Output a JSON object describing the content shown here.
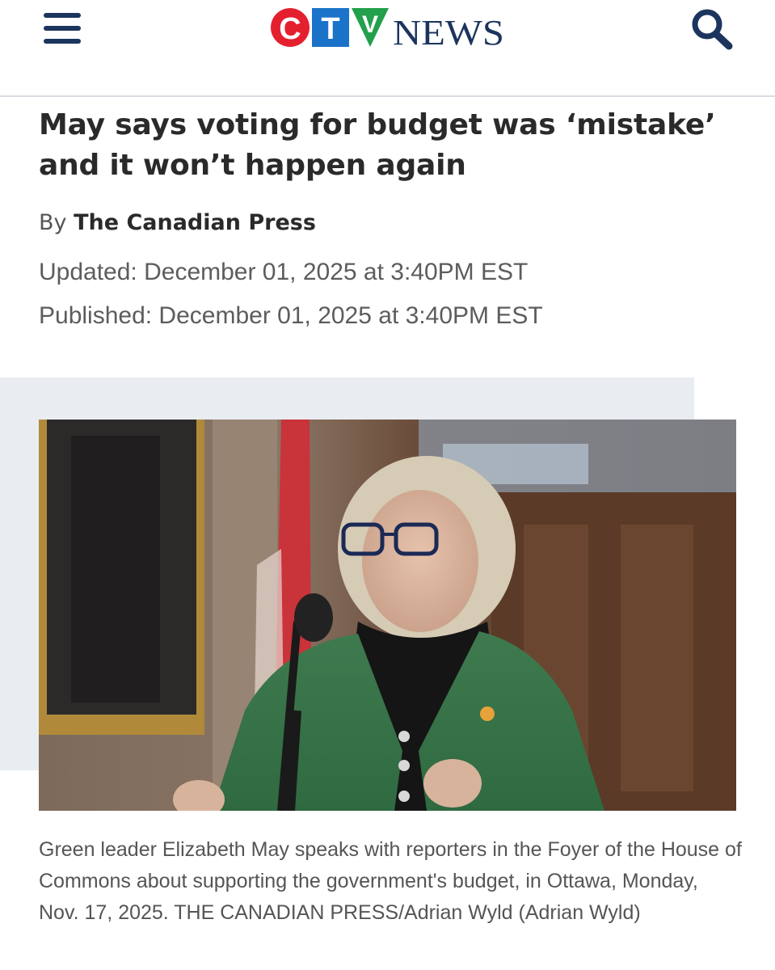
{
  "header": {
    "menu_icon": "hamburger-menu-icon",
    "logo": {
      "letters": [
        "C",
        "T",
        "V"
      ],
      "wordmark": "NEWS",
      "colors": {
        "c_red": "#e4202f",
        "t_blue": "#1a73c9",
        "v_green": "#22a04b",
        "wordmark": "#1c355e"
      }
    },
    "search_icon": "search-icon"
  },
  "article": {
    "headline": "May says voting for budget was ‘mistake’ and it won’t happen again",
    "byline_prefix": "By",
    "author": "The Canadian Press",
    "updated": "Updated: December 01, 2025 at 3:40PM EST",
    "published": "Published: December 01, 2025 at 3:40PM EST",
    "caption": "Green leader Elizabeth May speaks with reporters in the Foyer of the House of Commons about supporting the government's budget, in Ottawa, Monday, Nov. 17, 2025. THE CANADIAN PRESS/Adrian Wyld (Adrian Wyld)"
  },
  "colors": {
    "brand_navy": "#1c355e",
    "media_band": "#e9ecf1",
    "divider": "#d9dde3"
  }
}
